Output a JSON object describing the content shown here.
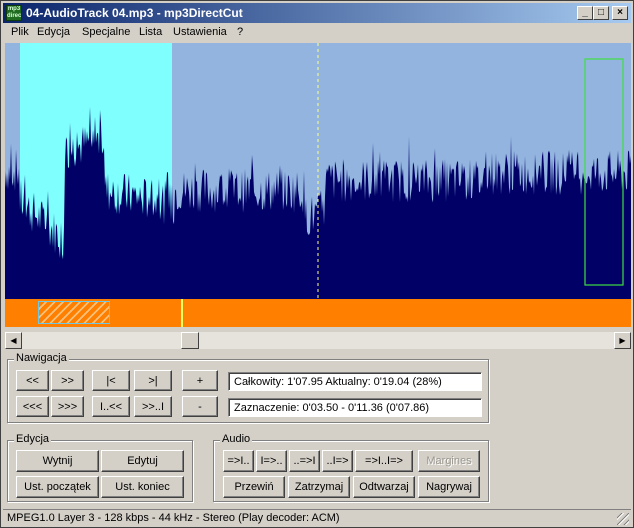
{
  "window": {
    "title": "04-AudioTrack 04.mp3 - mp3DirectCut",
    "icon_text": "mp3 direct cut",
    "minimize_glyph": "_",
    "maximize_glyph": "□",
    "close_glyph": "×"
  },
  "menu": [
    "Plik",
    "Edycja",
    "Specjalne",
    "Lista",
    "Ustawienia",
    "?"
  ],
  "colors": {
    "wave_bg": "#92b4df",
    "wave_fill": "#000066",
    "selection": "#80ffff",
    "timeline": "#ff8000",
    "marker_box": "#40e040",
    "cursor_line": "#ffff80"
  },
  "navigation": {
    "title": "Nawigacja",
    "row1": [
      "<<",
      ">>",
      "|<",
      ">|",
      "+"
    ],
    "row2": [
      "<<<",
      ">>>",
      "I..<<",
      ">>..I",
      "-"
    ],
    "total_label": "Całkowity: 1'07.95  Aktualny: 0'19.04  (28%)",
    "selection_label": "Zaznaczenie: 0'03.50 - 0'11.36 (0'07.86)"
  },
  "edit": {
    "title": "Edycja",
    "cut": "Wytnij",
    "edit": "Edytuj",
    "set_start": "Ust. początek",
    "set_end": "Ust. koniec"
  },
  "audio": {
    "title": "Audio",
    "row1": [
      "=>I..",
      "I=>..",
      "..=>I",
      "..I=>",
      "=>I..I=>"
    ],
    "margins": "Margines",
    "row2": [
      "Przewiń",
      "Zatrzymaj",
      "Odtwarzaj",
      "Nagrywaj"
    ]
  },
  "status": "MPEG1.0 Layer 3 - 128 kbps - 44 kHz - Stereo   (Play decoder: ACM)"
}
